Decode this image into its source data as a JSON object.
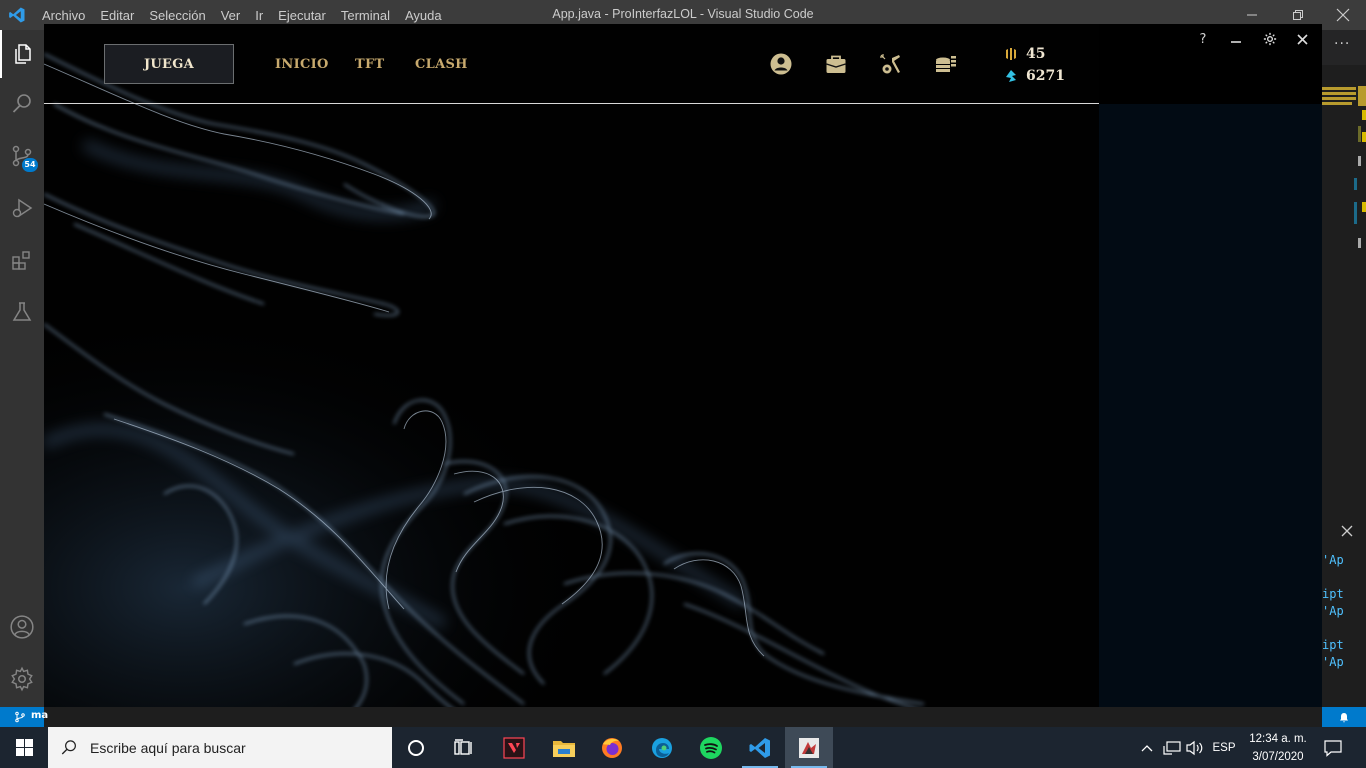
{
  "vscode": {
    "menu": [
      "Archivo",
      "Editar",
      "Selección",
      "Ver",
      "Ir",
      "Ejecutar",
      "Terminal",
      "Ayuda"
    ],
    "window_title": "App.java - ProInterfazLOL - Visual Studio Code",
    "scm_badge": "54",
    "more_actions": "···",
    "status_branch": "ma",
    "code_fragments": [
      "'Ap",
      "ipt",
      "'Ap",
      "ipt",
      "'Ap"
    ],
    "activity_icons": [
      "explorer-icon",
      "search-icon",
      "source-control-icon",
      "run-debug-icon",
      "extensions-icon",
      "testing-icon",
      "accounts-icon",
      "settings-gear-icon"
    ]
  },
  "app": {
    "play_button": "JUEGA",
    "nav": [
      "INICIO",
      "TFT",
      "CLASH"
    ],
    "header_icons": [
      "profile-icon",
      "collection-icon",
      "loot-icon",
      "store-icon"
    ],
    "blue_essence": "45",
    "riot_points": "6271",
    "window_controls": [
      "?",
      "–",
      "⚙",
      "✕"
    ]
  },
  "taskbar": {
    "search_placeholder": "Escribe aquí para buscar",
    "apps": [
      "cortana-icon",
      "task-view-icon",
      "valorant-icon",
      "file-explorer-icon",
      "firefox-icon",
      "edge-icon",
      "spotify-icon",
      "vscode-icon",
      "java-app-icon"
    ],
    "language": "ESP",
    "time": "12:34 a. m.",
    "date": "3/07/2020"
  },
  "colors": {
    "gold": "#c8aa6e",
    "accent_blue": "#007acc",
    "titlebar": "#3c3c3c"
  }
}
